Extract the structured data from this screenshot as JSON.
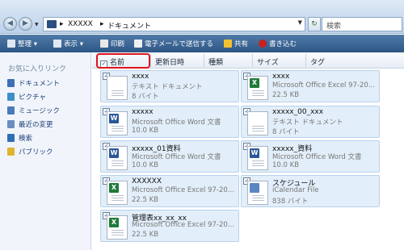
{
  "address": {
    "back_glyph": "◀",
    "forward_glyph": "▶",
    "history_glyph": "▼",
    "crumbs": [
      "XXXXX",
      "ドキュメント"
    ],
    "crumb_sep": "▸",
    "path_drop_glyph": "▼",
    "refresh_glyph": "↻",
    "search_placeholder": "検索"
  },
  "toolbar": {
    "organize": "整理",
    "views": "表示",
    "print": "印刷",
    "email": "電子メールで送信する",
    "share": "共有",
    "burn": "書き込む",
    "colors": {
      "organize": "#dfe8f2",
      "views": "#dfe8f2",
      "print": "#e8e8e8",
      "email": "#f0f0f0",
      "share": "#f2c232",
      "burn": "#c82020"
    }
  },
  "sidebar": {
    "header": "お気に入りリンク",
    "items": [
      {
        "label": "ドキュメント",
        "icon": "documents-icon",
        "color": "#3d6fb5"
      },
      {
        "label": "ピクチャ",
        "icon": "pictures-icon",
        "color": "#3d8fc7"
      },
      {
        "label": "ミュージック",
        "icon": "music-icon",
        "color": "#4a7ab8"
      },
      {
        "label": "最近の変更",
        "icon": "recent-changes-icon",
        "color": "#6a8cc0"
      },
      {
        "label": "検索",
        "icon": "search-icon",
        "color": "#2f6fb5"
      },
      {
        "label": "パブリック",
        "icon": "public-folder-icon",
        "color": "#e0b431"
      }
    ]
  },
  "columns": {
    "check": "✓",
    "name": "名前",
    "modified": "更新日時",
    "type": "種類",
    "size": "サイズ",
    "tags": "タグ"
  },
  "files": [
    {
      "name": "xxxx",
      "type": "テキスト ドキュメント",
      "size": "8 バイト",
      "icon": "text-file-icon",
      "badge": "",
      "badge_color": ""
    },
    {
      "name": "xxxx",
      "type": "Microsoft Office Excel 97-20...",
      "size": "22.5 KB",
      "icon": "excel-file-icon",
      "badge": "X",
      "badge_color": "#1f7a3a"
    },
    {
      "name": "xxxxx",
      "type": "Microsoft Office Word 文書",
      "size": "10.0 KB",
      "icon": "word-file-icon",
      "badge": "W",
      "badge_color": "#2b579a"
    },
    {
      "name": "xxxxx_00_xxx",
      "type": "テキスト ドキュメント",
      "size": "8 バイト",
      "icon": "text-file-icon",
      "badge": "",
      "badge_color": ""
    },
    {
      "name": "xxxxx_01資料",
      "type": "Microsoft Office Word 文書",
      "size": "10.0 KB",
      "icon": "word-file-icon",
      "badge": "W",
      "badge_color": "#2b579a"
    },
    {
      "name": "xxxxx_資料",
      "type": "Microsoft Office Word 文書",
      "size": "10.0 KB",
      "icon": "word-file-icon",
      "badge": "W",
      "badge_color": "#2b579a"
    },
    {
      "name": "XXXXXX",
      "type": "Microsoft Office Excel 97-20...",
      "size": "22.5 KB",
      "icon": "excel-file-icon",
      "badge": "X",
      "badge_color": "#1f7a3a"
    },
    {
      "name": "スケジュール",
      "type": "iCalendar File",
      "size": "838 バイト",
      "icon": "calendar-file-icon",
      "badge": "",
      "badge_color": ""
    },
    {
      "name": "管理表xx_xx_xx",
      "type": "Microsoft Office Excel 97-20...",
      "size": "22.5 KB",
      "icon": "excel-file-icon",
      "badge": "X",
      "badge_color": "#1f7a3a"
    }
  ]
}
